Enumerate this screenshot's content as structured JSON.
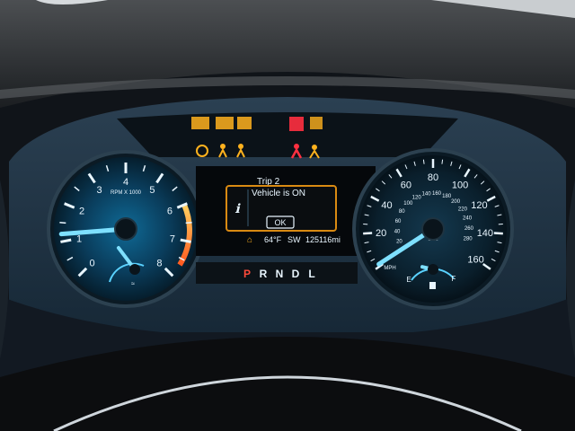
{
  "tachometer": {
    "ticks": [
      "0",
      "1",
      "2",
      "3",
      "4",
      "5",
      "6",
      "7",
      "8"
    ],
    "unit_label": "RPM X 1000",
    "needle_rpm_x1000": 1.2
  },
  "speedometer": {
    "mph_ticks": [
      "0",
      "20",
      "40",
      "60",
      "80",
      "100",
      "120",
      "140",
      "160"
    ],
    "kmh_ticks": [
      "20",
      "40",
      "60",
      "80",
      "100",
      "120",
      "140",
      "160",
      "180",
      "200",
      "220",
      "240",
      "260",
      "280"
    ],
    "unit_mph": "MPH",
    "unit_kmh": "km/h",
    "needle_mph": 0
  },
  "display": {
    "title": "Trip 2",
    "message": "Vehicle is ON",
    "ok_label": "OK",
    "temperature": "64°F",
    "heading": "SW",
    "odometer": "125116mi"
  },
  "gear": {
    "letters": [
      "P",
      "R",
      "N",
      "D",
      "L"
    ],
    "selected": "P"
  },
  "fuel": {
    "empty_label": "E",
    "full_label": "F",
    "level": 0.3
  },
  "engine_temp_level": 0.3,
  "warning_lights": {
    "amber_count": 3,
    "red_count": 2
  },
  "colors": {
    "backlight_blue": "#7fd3ff",
    "needle_glow": "#5ad2ff",
    "amber": "#ffb21e",
    "red": "#ff3040",
    "gear_selected": "#ff4a3a",
    "display_border": "#d98a12"
  }
}
